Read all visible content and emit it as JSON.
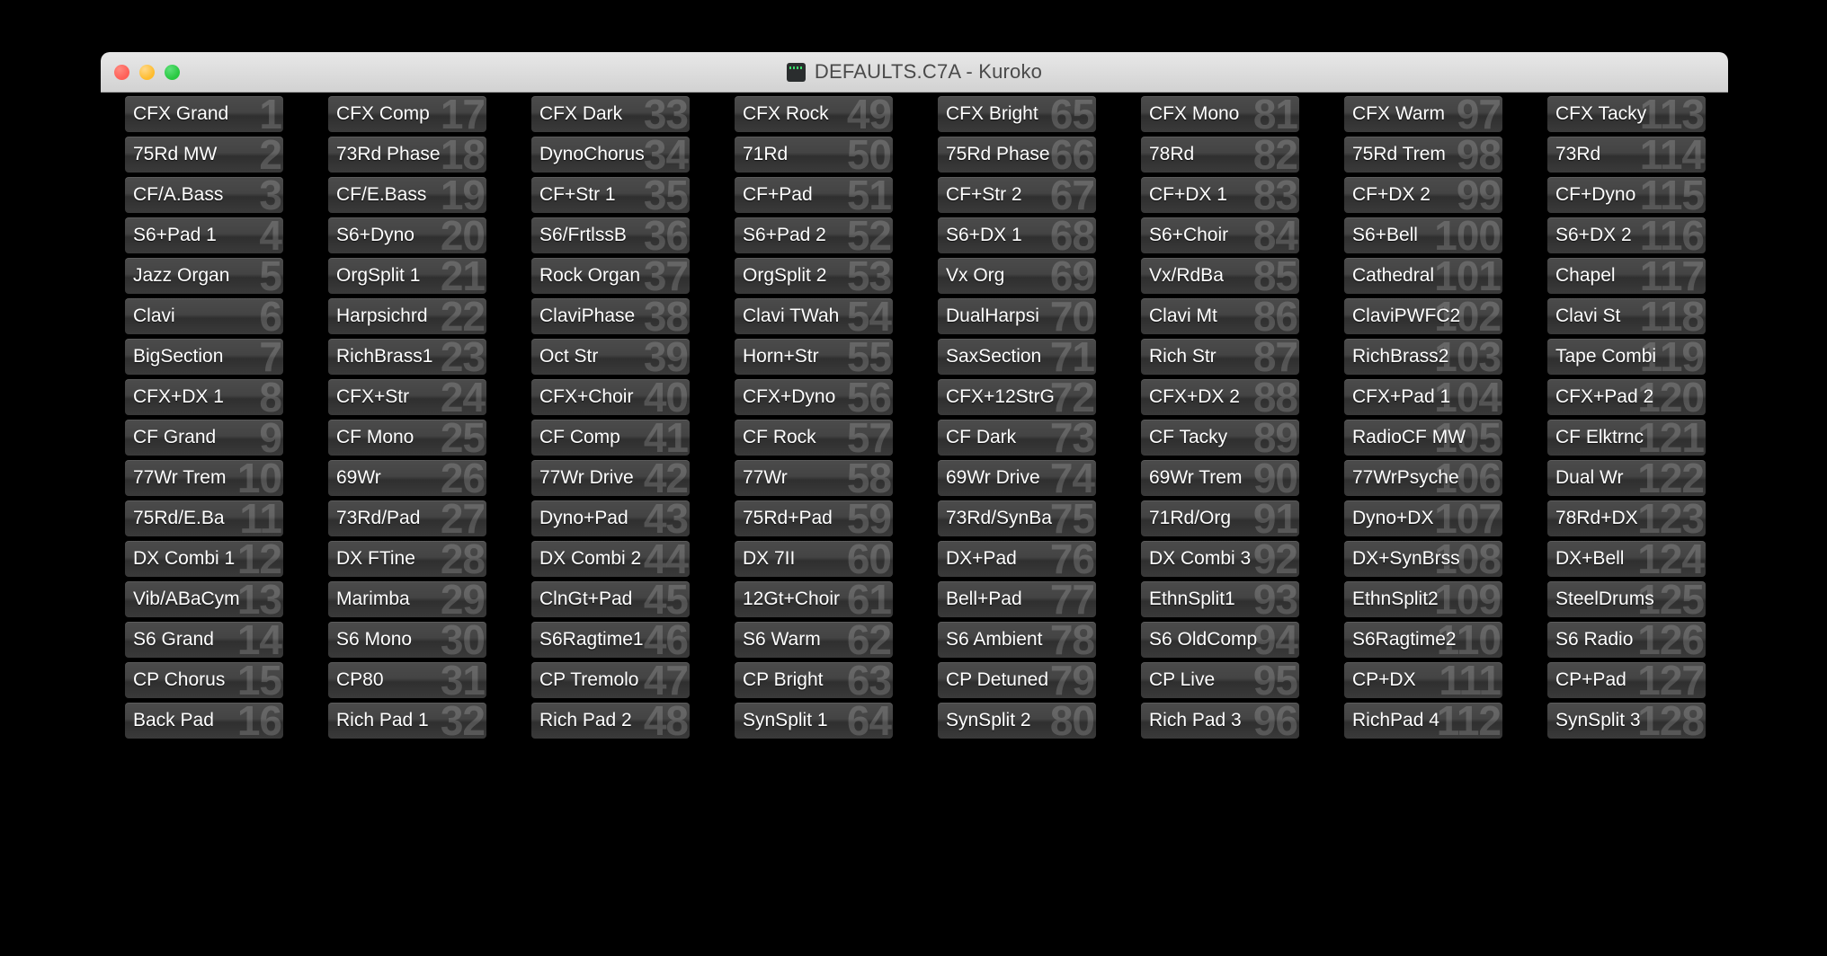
{
  "window": {
    "title": "DEFAULTS.C7A - Kuroko",
    "title_icon": "terminal-icon",
    "traffic_lights": {
      "close": "close-button",
      "minimize": "minimize-button",
      "maximize": "maximize-button",
      "close_color": "#ff5f57",
      "minimize_color": "#febc2e",
      "maximize_color": "#28c840"
    }
  },
  "colors": {
    "desktop_background": "#000000",
    "titlebar": "#dcdcdc",
    "title_text": "#4a4a4a",
    "button_face": "#444444",
    "button_label": "#ffffff",
    "button_number": "rgba(255,255,255,0.17)"
  },
  "presets": {
    "columns": [
      {
        "index": 1,
        "buttons": [
          {
            "number": "1",
            "label": "CFX Grand"
          },
          {
            "number": "2",
            "label": "75Rd MW"
          },
          {
            "number": "3",
            "label": "CF/A.Bass"
          },
          {
            "number": "4",
            "label": "S6+Pad 1"
          },
          {
            "number": "5",
            "label": "Jazz Organ"
          },
          {
            "number": "6",
            "label": "Clavi"
          },
          {
            "number": "7",
            "label": "BigSection"
          },
          {
            "number": "8",
            "label": "CFX+DX 1"
          },
          {
            "number": "9",
            "label": "CF Grand"
          },
          {
            "number": "10",
            "label": "77Wr Trem"
          },
          {
            "number": "11",
            "label": "75Rd/E.Ba"
          },
          {
            "number": "12",
            "label": "DX Combi 1"
          },
          {
            "number": "13",
            "label": "Vib/ABaCym"
          },
          {
            "number": "14",
            "label": "S6 Grand"
          },
          {
            "number": "15",
            "label": "CP Chorus"
          },
          {
            "number": "16",
            "label": "Back Pad"
          }
        ]
      },
      {
        "index": 2,
        "buttons": [
          {
            "number": "17",
            "label": "CFX Comp"
          },
          {
            "number": "18",
            "label": "73Rd Phase"
          },
          {
            "number": "19",
            "label": "CF/E.Bass"
          },
          {
            "number": "20",
            "label": "S6+Dyno"
          },
          {
            "number": "21",
            "label": "OrgSplit 1"
          },
          {
            "number": "22",
            "label": "Harpsichrd"
          },
          {
            "number": "23",
            "label": "RichBrass1"
          },
          {
            "number": "24",
            "label": "CFX+Str"
          },
          {
            "number": "25",
            "label": "CF Mono"
          },
          {
            "number": "26",
            "label": "69Wr"
          },
          {
            "number": "27",
            "label": "73Rd/Pad"
          },
          {
            "number": "28",
            "label": "DX FTine"
          },
          {
            "number": "29",
            "label": "Marimba"
          },
          {
            "number": "30",
            "label": "S6 Mono"
          },
          {
            "number": "31",
            "label": "CP80"
          },
          {
            "number": "32",
            "label": "Rich Pad 1"
          }
        ]
      },
      {
        "index": 3,
        "buttons": [
          {
            "number": "33",
            "label": "CFX Dark"
          },
          {
            "number": "34",
            "label": "DynoChorus"
          },
          {
            "number": "35",
            "label": "CF+Str 1"
          },
          {
            "number": "36",
            "label": "S6/FrtlssB"
          },
          {
            "number": "37",
            "label": "Rock Organ"
          },
          {
            "number": "38",
            "label": "ClaviPhase"
          },
          {
            "number": "39",
            "label": "Oct Str"
          },
          {
            "number": "40",
            "label": "CFX+Choir"
          },
          {
            "number": "41",
            "label": "CF Comp"
          },
          {
            "number": "42",
            "label": "77Wr Drive"
          },
          {
            "number": "43",
            "label": "Dyno+Pad"
          },
          {
            "number": "44",
            "label": "DX Combi 2"
          },
          {
            "number": "45",
            "label": "ClnGt+Pad"
          },
          {
            "number": "46",
            "label": "S6Ragtime1"
          },
          {
            "number": "47",
            "label": "CP Tremolo"
          },
          {
            "number": "48",
            "label": "Rich Pad 2"
          }
        ]
      },
      {
        "index": 4,
        "buttons": [
          {
            "number": "49",
            "label": "CFX Rock"
          },
          {
            "number": "50",
            "label": "71Rd"
          },
          {
            "number": "51",
            "label": "CF+Pad"
          },
          {
            "number": "52",
            "label": "S6+Pad 2"
          },
          {
            "number": "53",
            "label": "OrgSplit 2"
          },
          {
            "number": "54",
            "label": "Clavi TWah"
          },
          {
            "number": "55",
            "label": "Horn+Str"
          },
          {
            "number": "56",
            "label": "CFX+Dyno"
          },
          {
            "number": "57",
            "label": "CF Rock"
          },
          {
            "number": "58",
            "label": "77Wr"
          },
          {
            "number": "59",
            "label": "75Rd+Pad"
          },
          {
            "number": "60",
            "label": "DX 7II"
          },
          {
            "number": "61",
            "label": "12Gt+Choir"
          },
          {
            "number": "62",
            "label": "S6 Warm"
          },
          {
            "number": "63",
            "label": "CP Bright"
          },
          {
            "number": "64",
            "label": "SynSplit 1"
          }
        ]
      },
      {
        "index": 5,
        "buttons": [
          {
            "number": "65",
            "label": "CFX Bright"
          },
          {
            "number": "66",
            "label": "75Rd Phase"
          },
          {
            "number": "67",
            "label": "CF+Str 2"
          },
          {
            "number": "68",
            "label": "S6+DX 1"
          },
          {
            "number": "69",
            "label": "Vx Org"
          },
          {
            "number": "70",
            "label": "DualHarpsi"
          },
          {
            "number": "71",
            "label": "SaxSection"
          },
          {
            "number": "72",
            "label": "CFX+12StrG"
          },
          {
            "number": "73",
            "label": "CF Dark"
          },
          {
            "number": "74",
            "label": "69Wr Drive"
          },
          {
            "number": "75",
            "label": "73Rd/SynBa"
          },
          {
            "number": "76",
            "label": "DX+Pad"
          },
          {
            "number": "77",
            "label": "Bell+Pad"
          },
          {
            "number": "78",
            "label": "S6 Ambient"
          },
          {
            "number": "79",
            "label": "CP Detuned"
          },
          {
            "number": "80",
            "label": "SynSplit 2"
          }
        ]
      },
      {
        "index": 6,
        "buttons": [
          {
            "number": "81",
            "label": "CFX Mono"
          },
          {
            "number": "82",
            "label": "78Rd"
          },
          {
            "number": "83",
            "label": "CF+DX 1"
          },
          {
            "number": "84",
            "label": "S6+Choir"
          },
          {
            "number": "85",
            "label": "Vx/RdBa"
          },
          {
            "number": "86",
            "label": "Clavi Mt"
          },
          {
            "number": "87",
            "label": "Rich Str"
          },
          {
            "number": "88",
            "label": "CFX+DX 2"
          },
          {
            "number": "89",
            "label": "CF Tacky"
          },
          {
            "number": "90",
            "label": "69Wr Trem"
          },
          {
            "number": "91",
            "label": "71Rd/Org"
          },
          {
            "number": "92",
            "label": "DX Combi 3"
          },
          {
            "number": "93",
            "label": "EthnSplit1"
          },
          {
            "number": "94",
            "label": "S6 OldComp"
          },
          {
            "number": "95",
            "label": "CP Live"
          },
          {
            "number": "96",
            "label": "Rich Pad 3"
          }
        ]
      },
      {
        "index": 7,
        "buttons": [
          {
            "number": "97",
            "label": "CFX Warm"
          },
          {
            "number": "98",
            "label": "75Rd Trem"
          },
          {
            "number": "99",
            "label": "CF+DX 2"
          },
          {
            "number": "100",
            "label": "S6+Bell"
          },
          {
            "number": "101",
            "label": "Cathedral"
          },
          {
            "number": "102",
            "label": "ClaviPWFC2"
          },
          {
            "number": "103",
            "label": "RichBrass2"
          },
          {
            "number": "104",
            "label": "CFX+Pad 1"
          },
          {
            "number": "105",
            "label": "RadioCF MW"
          },
          {
            "number": "106",
            "label": "77WrPsyche"
          },
          {
            "number": "107",
            "label": "Dyno+DX"
          },
          {
            "number": "108",
            "label": "DX+SynBrss"
          },
          {
            "number": "109",
            "label": "EthnSplit2"
          },
          {
            "number": "110",
            "label": "S6Ragtime2"
          },
          {
            "number": "111",
            "label": "CP+DX"
          },
          {
            "number": "112",
            "label": "RichPad 4"
          }
        ]
      },
      {
        "index": 8,
        "buttons": [
          {
            "number": "113",
            "label": "CFX Tacky"
          },
          {
            "number": "114",
            "label": "73Rd"
          },
          {
            "number": "115",
            "label": "CF+Dyno"
          },
          {
            "number": "116",
            "label": "S6+DX 2"
          },
          {
            "number": "117",
            "label": "Chapel"
          },
          {
            "number": "118",
            "label": "Clavi St"
          },
          {
            "number": "119",
            "label": "Tape Combi"
          },
          {
            "number": "120",
            "label": "CFX+Pad 2"
          },
          {
            "number": "121",
            "label": "CF Elktrnc"
          },
          {
            "number": "122",
            "label": "Dual Wr"
          },
          {
            "number": "123",
            "label": "78Rd+DX"
          },
          {
            "number": "124",
            "label": "DX+Bell"
          },
          {
            "number": "125",
            "label": "SteelDrums"
          },
          {
            "number": "126",
            "label": "S6 Radio"
          },
          {
            "number": "127",
            "label": "CP+Pad"
          },
          {
            "number": "128",
            "label": "SynSplit 3"
          }
        ]
      }
    ]
  }
}
